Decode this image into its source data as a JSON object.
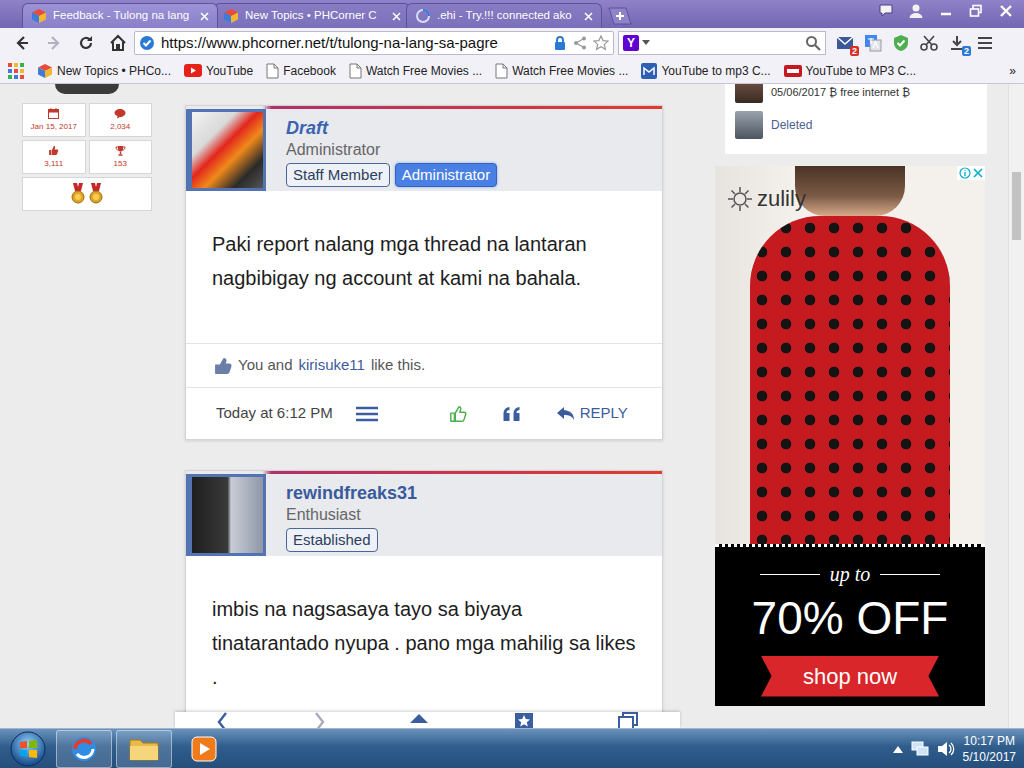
{
  "tabs": [
    {
      "label": "Feedback - Tulong na lang",
      "selected": true,
      "loading": false
    },
    {
      "label": "New Topics • PHCorner C",
      "selected": false,
      "loading": false
    },
    {
      "label": ".ehi - Try.!!! connected ako",
      "selected": false,
      "loading": true
    }
  ],
  "address": {
    "url": "https://www.phcorner.net/t/tulong-na-lang-sa-pagre",
    "back_enabled": true,
    "forward_enabled": false,
    "search_engine": "Y"
  },
  "extension_badges": {
    "mail": "2",
    "downloads": "2"
  },
  "bookmarks": [
    {
      "label": "New Topics • PHCo...",
      "kind": "site"
    },
    {
      "label": "YouTube",
      "kind": "youtube"
    },
    {
      "label": "Facebook",
      "kind": "page"
    },
    {
      "label": "Watch Free Movies ...",
      "kind": "page"
    },
    {
      "label": "Watch Free Movies ...",
      "kind": "page"
    },
    {
      "label": "YouTube to mp3 C...",
      "kind": "mp3"
    },
    {
      "label": "YouTube to MP3 C...",
      "kind": "converter"
    }
  ],
  "bookmarks_more": "»",
  "member_stats": [
    {
      "value": "Jan 15, 2017",
      "kind": "calendar"
    },
    {
      "value": "2,034",
      "kind": "messages"
    },
    {
      "value": "3,111",
      "kind": "likes"
    },
    {
      "value": "153",
      "kind": "trophy"
    }
  ],
  "posts": [
    {
      "author": "Draft",
      "kind": "admin",
      "title": "Administrator",
      "banners": [
        {
          "label": "Staff Member",
          "kind": "outline"
        },
        {
          "label": "Administrator",
          "kind": "filled"
        }
      ],
      "message": "Paki report nalang mga thread na lantaran nagbibigay ng account at kami na bahala.",
      "likes": {
        "before": "You and",
        "user": "kirisuke11",
        "after": "like this."
      },
      "date": "Today at 6:12 PM",
      "liked": true,
      "reply": "REPLY"
    },
    {
      "author": "rewindfreaks31",
      "kind": "member",
      "title": "Enthusiast",
      "banners": [
        {
          "label": "Established",
          "kind": "outline"
        }
      ],
      "message": "imbis na nagsasaya tayo sa biyaya tinatarantado nyupa . pano mga mahilig sa likes ."
    }
  ],
  "activity": [
    {
      "text": "05/06/2017 ₿ free internet ₿",
      "kind": "post"
    },
    {
      "text": "Deleted",
      "kind": "link"
    }
  ],
  "ad": {
    "brand": "zulily",
    "tagline": "up to",
    "headline": "70% OFF",
    "cta": "shop now"
  },
  "taskbar": {
    "time": "10:17 PM",
    "date": "5/10/2017"
  }
}
